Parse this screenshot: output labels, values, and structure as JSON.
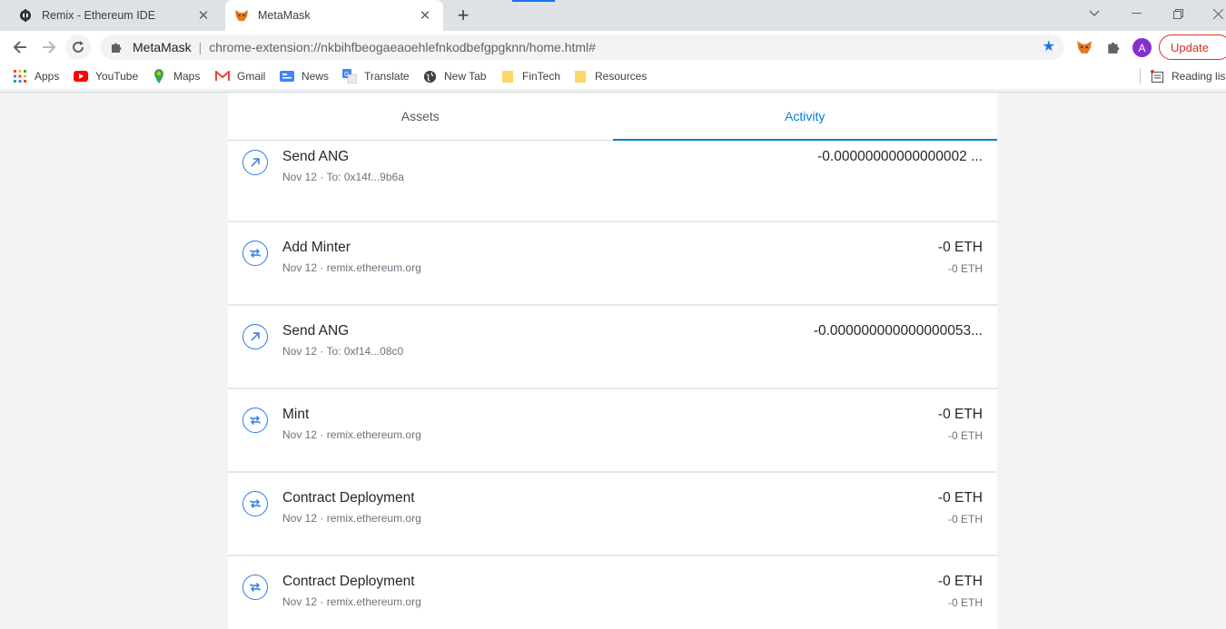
{
  "browser": {
    "tabs": [
      {
        "title": "Remix - Ethereum IDE",
        "active": false
      },
      {
        "title": "MetaMask",
        "active": true
      }
    ],
    "omnibox": {
      "site_name": "MetaMask",
      "url": "chrome-extension://nkbihfbeogaeaoehlefnkodbefgpgknn/home.html#"
    },
    "avatar_letter": "A",
    "update_label": "Update",
    "bookmarks": [
      "Apps",
      "YouTube",
      "Maps",
      "Gmail",
      "News",
      "Translate",
      "New Tab",
      "FinTech",
      "Resources"
    ],
    "reading_list": "Reading list"
  },
  "metamask": {
    "tabs": [
      {
        "label": "Assets",
        "active": false
      },
      {
        "label": "Activity",
        "active": true
      }
    ],
    "transactions": [
      {
        "title": "Send ANG",
        "date": "Nov 12",
        "detail": "To: 0x14f...9b6a",
        "amount": "-0.00000000000000002 ...",
        "fiat": "",
        "type": "send"
      },
      {
        "title": "Add Minter",
        "date": "Nov 12",
        "detail": "remix.ethereum.org",
        "amount": "-0 ETH",
        "fiat": "-0 ETH",
        "type": "interaction"
      },
      {
        "title": "Send ANG",
        "date": "Nov 12",
        "detail": "To: 0xf14...08c0",
        "amount": "-0.000000000000000053...",
        "fiat": "",
        "type": "send"
      },
      {
        "title": "Mint",
        "date": "Nov 12",
        "detail": "remix.ethereum.org",
        "amount": "-0 ETH",
        "fiat": "-0 ETH",
        "type": "interaction"
      },
      {
        "title": "Contract Deployment",
        "date": "Nov 12",
        "detail": "remix.ethereum.org",
        "amount": "-0 ETH",
        "fiat": "-0 ETH",
        "type": "interaction"
      },
      {
        "title": "Contract Deployment",
        "date": "Nov 12",
        "detail": "remix.ethereum.org",
        "amount": "-0 ETH",
        "fiat": "-0 ETH",
        "type": "interaction"
      }
    ],
    "date_separator": " · ",
    "accent_color": "#037dd6",
    "icon_color": "#2c7be5"
  }
}
